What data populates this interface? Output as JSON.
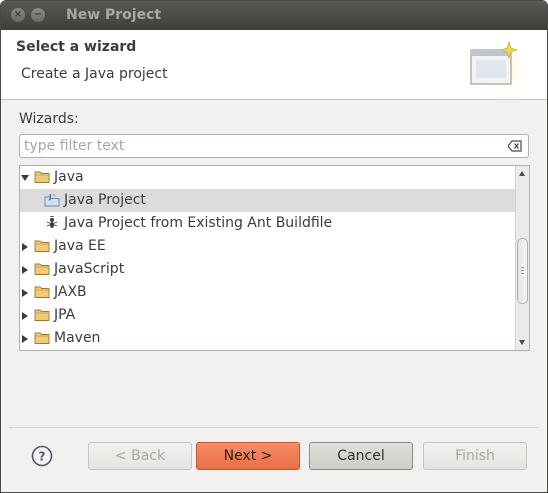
{
  "window": {
    "title": "New Project",
    "close_glyph": "×",
    "minimize_glyph": "−"
  },
  "header": {
    "title": "Select a wizard",
    "description": "Create a Java project",
    "art_icon": "wizard-banner-icon"
  },
  "filter": {
    "label": "Wizards:",
    "placeholder": "type filter text",
    "value": "",
    "clear_icon": "clear-filter-icon"
  },
  "tree": {
    "items": [
      {
        "label": "Java",
        "type": "folder",
        "expanded": true,
        "level": 0,
        "selected": false
      },
      {
        "label": "Java Project",
        "type": "java-project",
        "level": 1,
        "selected": true
      },
      {
        "label": "Java Project from Existing Ant Buildfile",
        "type": "ant",
        "level": 1,
        "selected": false
      },
      {
        "label": "Java EE",
        "type": "folder",
        "expanded": false,
        "level": 0,
        "selected": false
      },
      {
        "label": "JavaScript",
        "type": "folder",
        "expanded": false,
        "level": 0,
        "selected": false
      },
      {
        "label": "JAXB",
        "type": "folder",
        "expanded": false,
        "level": 0,
        "selected": false
      },
      {
        "label": "JPA",
        "type": "folder",
        "expanded": false,
        "level": 0,
        "selected": false
      },
      {
        "label": "Maven",
        "type": "folder",
        "expanded": false,
        "level": 0,
        "selected": false
      }
    ]
  },
  "buttons": {
    "help_icon": "help-icon",
    "back": "< Back",
    "next": "Next >",
    "cancel": "Cancel",
    "finish": "Finish"
  },
  "colors": {
    "primary_button": "#ea6f45",
    "selection": "#dcdcdc",
    "titlebar": "#3f3e3a"
  }
}
